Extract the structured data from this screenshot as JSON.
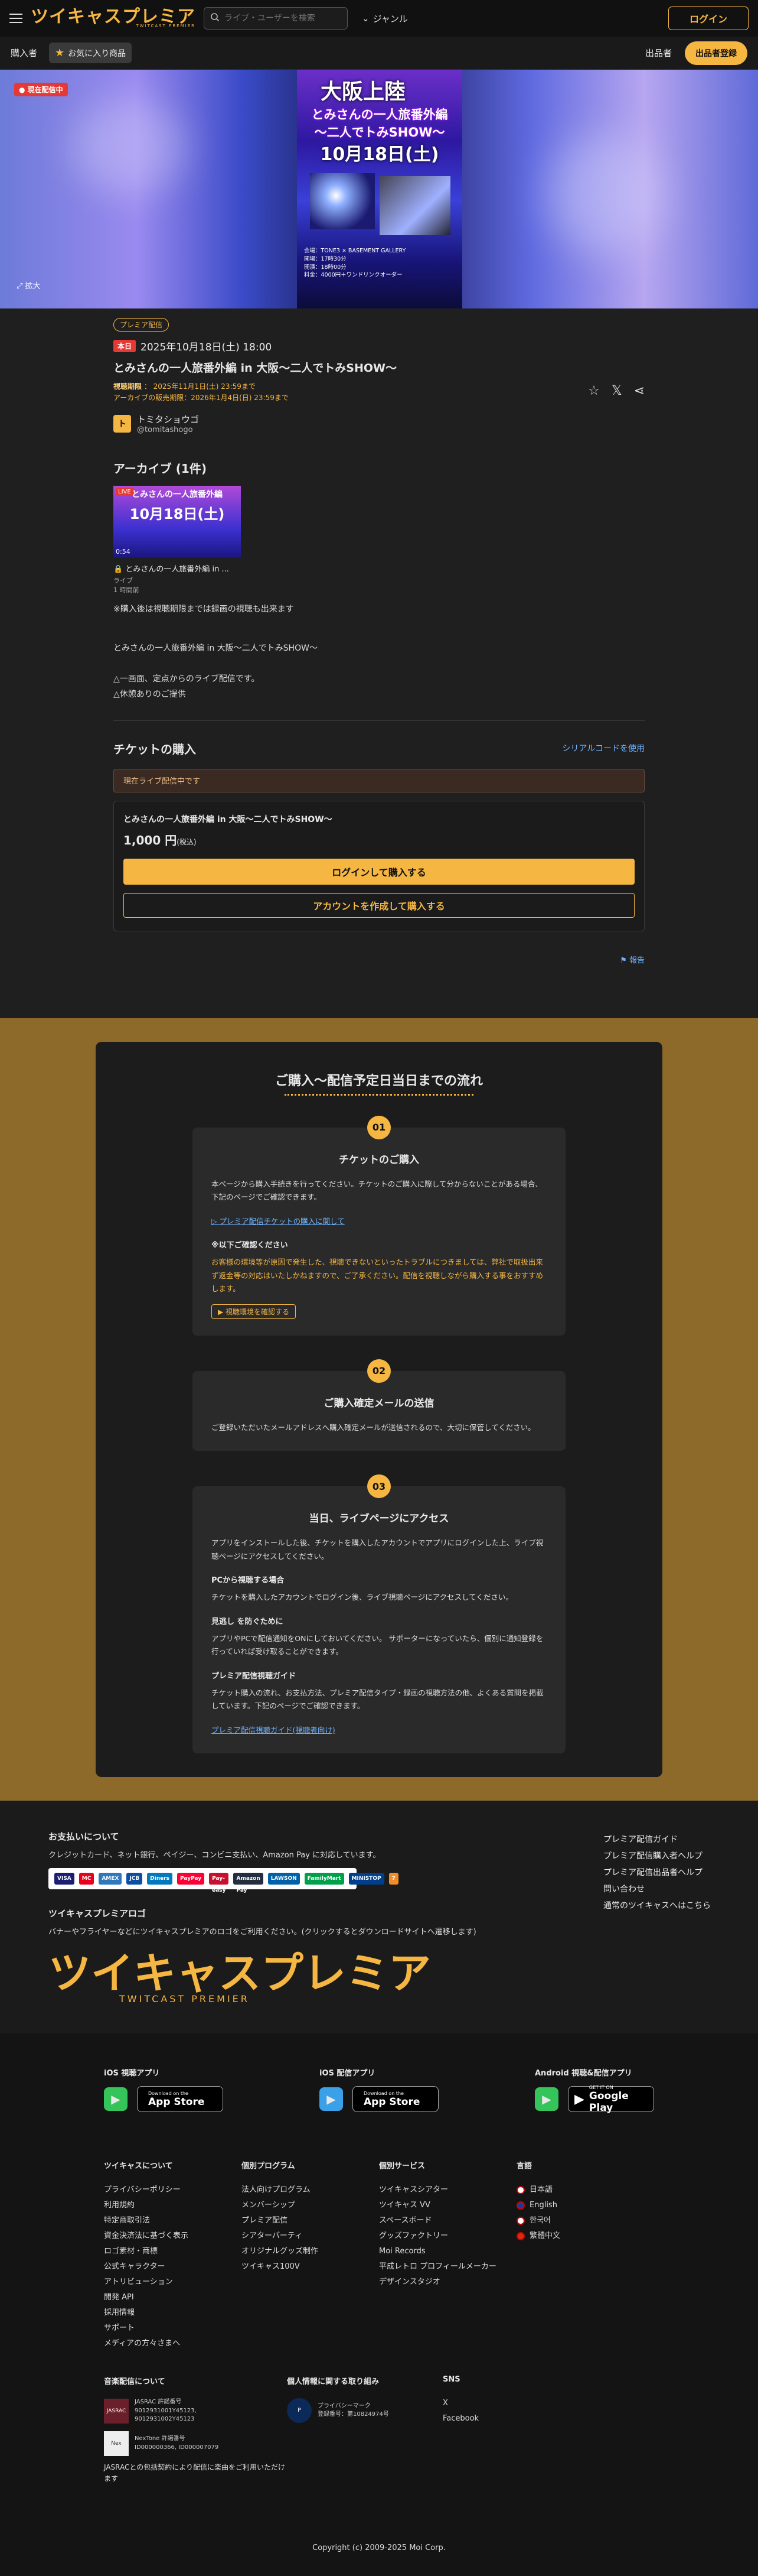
{
  "header": {
    "logo": "ツイキャスプレミア",
    "logo_sub": "TWITCAST PREMIER",
    "search_placeholder": "ライブ・ユーザーを検索",
    "genre": "ジャンル",
    "login": "ログイン"
  },
  "subnav": {
    "buyer": "購入者",
    "favorites": "お気に入り商品",
    "seller": "出品者",
    "register": "出品者登録"
  },
  "hero": {
    "live_tag": "● 現在配信中",
    "expand": "拡大",
    "poster_title": "大阪上陸",
    "poster_sub": "とみさんの一人旅番外編",
    "poster_sub2": "〜二人でトみSHOW〜",
    "poster_date": "10月18日(土)",
    "poster_info": "会場：TONE3 × BASEMENT GALLERY\n開場：17時30分\n開演：18時00分\n料金：4000円＋ワンドリンクオーダー"
  },
  "event": {
    "badge": "プレミア配信",
    "today": "本日",
    "datetime": "2025年10月18日(土) 18:00",
    "title": "とみさんの一人旅番外編 in 大阪〜二人でトみSHOW〜",
    "period_label": "視聴期限",
    "period_value": "2025年11月1日(土) 23:59まで",
    "sale_period": "アーカイブの販売期限：2026年1月4日(日) 23:59まで",
    "owner_name": "トミタショウゴ",
    "owner_id": "@tomitashogo",
    "archive_title": "アーカイブ (1件)",
    "archive_thumb_line1": "とみさんの一人旅番外編",
    "archive_thumb_line2": "10月18日(土)",
    "archive_live": "LIVE",
    "archive_duration": "0:54",
    "archive_name": "とみさんの一人旅番外編 in ...",
    "archive_type": "ライブ",
    "archive_ago": "1 時間前",
    "note": "※購入後は視聴期限までは録画の視聴も出来ます",
    "description": "とみさんの一人旅番外編 in 大阪〜二人でトみSHOW〜\n\n△一画面、定点からのライブ配信です。\n△休憩ありのご提供"
  },
  "ticket": {
    "heading": "チケットの購入",
    "serial": "シリアルコードを使用",
    "status": "現在ライブ配信中です",
    "name": "とみさんの一人旅番外編 in 大阪〜二人でトみSHOW〜",
    "price": "1,000 円",
    "tax": "(税込)",
    "login_buy": "ログインして購入する",
    "create_buy": "アカウントを作成して購入する",
    "report": "報告"
  },
  "flow": {
    "title": "ご購入〜配信予定日当日までの流れ",
    "step1": {
      "num": "01",
      "title": "チケットのご購入",
      "p1": "本ページから購入手続きを行ってください。チケットのご購入に際して分からないことがある場合、下記のページでご確認できます。",
      "link": "プレミア配信チケットの購入に関して",
      "h4": "※以下ご確認ください",
      "warn": "お客様の環境等が原因で発生した、視聴できないといったトラブルにつきましては、弊社で取扱出来ず返金等の対応はいたしかねますので、ご了承ください。配信を視聴しながら購入する事をおすすめします。",
      "check": "▶ 視聴環境を確認する"
    },
    "step2": {
      "num": "02",
      "title": "ご購入確定メールの送信",
      "p1": "ご登録いただいたメールアドレスへ購入確定メールが送信されるので、大切に保管してください。"
    },
    "step3": {
      "num": "03",
      "title": "当日、ライブページにアクセス",
      "p1": "アプリをインストールした後、チケットを購入したアカウントでアプリにログインした上、ライブ視聴ページにアクセスしてください。",
      "h_pc": "PCから視聴する場合",
      "p_pc": "チケットを購入したアカウントでログイン後、ライブ視聴ページにアクセスしてください。",
      "h_miss": "見逃し を防ぐために",
      "p_miss": "アプリやPCで配信通知をONにしておいてください。 サポーターになっていたら、個別に通知登録を行っていれば受け取ることができます。",
      "h_guide": "プレミア配信視聴ガイド",
      "p_guide": "チケット購入の流れ、お支払方法、プレミア配信タイプ・録画の視聴方法の他、よくある質問を掲載しています。下記のページでご確認できます。",
      "link_guide": "プレミア配信視聴ガイド(視聴者向け)"
    }
  },
  "payment": {
    "title": "お支払いについて",
    "desc": "クレジットカード、ネット銀行、ペイジー、コンビニ支払い、Amazon Pay に対応しています。",
    "cards": [
      "VISA",
      "MC",
      "AMEX",
      "JCB",
      "Diners",
      "PayPay",
      "Pay-easy",
      "Amazon Pay",
      "LAWSON",
      "FamilyMart",
      "MINISTOP",
      "7"
    ],
    "logo_title": "ツイキャスプレミアロゴ",
    "logo_desc": "バナーやフライヤーなどにツイキャスプレミアのロゴをご利用ください。(クリックするとダウンロードサイトへ遷移します)",
    "big_logo": "ツイキャスプレミア",
    "big_logo_sub": "TWITCAST PREMIER",
    "right_links": [
      "プレミア配信ガイド",
      "プレミア配信購入者ヘルプ",
      "プレミア配信出品者ヘルプ",
      "問い合わせ",
      "通常のツイキャスへはこちら"
    ]
  },
  "footer": {
    "apps": [
      {
        "label": "iOS 視聴アプリ",
        "store_small": "Download on the",
        "store_big": "App Store",
        "color": "#35c45a"
      },
      {
        "label": "iOS 配信アプリ",
        "store_small": "Download on the",
        "store_big": "App Store",
        "color": "#3aa0e8"
      },
      {
        "label": "Android 視聴&配信アプリ",
        "store_small": "GET IT ON",
        "store_big": "Google Play",
        "color": "#35c45a"
      }
    ],
    "cols": [
      {
        "title": "ツイキャスについて",
        "items": [
          "プライバシーポリシー",
          "利用規約",
          "特定商取引法",
          "資金決済法に基づく表示",
          "ロゴ素材・商標",
          "公式キャラクター",
          "アトリビューション",
          "開発 API",
          "採用情報",
          "サポート",
          "メディアの方々さまへ"
        ]
      },
      {
        "title": "個別プログラム",
        "items": [
          "法人向けプログラム",
          "メンバーシップ",
          "プレミア配信",
          "シアターパーティ",
          "オリジナルグッズ制作",
          "ツイキャス100V"
        ]
      },
      {
        "title": "個別サービス",
        "items": [
          "ツイキャスシアター",
          "ツイキャス VV",
          "スペースボード",
          "グッズファクトリー",
          "Moi Records",
          "平成レトロ プロフィールメーカー",
          "デザインスタジオ"
        ]
      },
      {
        "title": "言語",
        "items": [
          "日本語",
          "English",
          "한국어",
          "繁體中文"
        ]
      }
    ],
    "music_title": "音楽配信について",
    "jasrac": "JASRAC 許諾番号\n9012931001Y45123,\n9012931002Y45123",
    "nextone": "NexTone 許諾番号\nID000000366, ID000007079",
    "jasrac_note": "JASRACとの包括契約により配信に楽曲をご利用いただけます",
    "privacy_title": "個人情報に関する取り組み",
    "privacy_text": "プライバシーマーク\n登録番号：第10824974号",
    "sns_title": "SNS",
    "sns_items": [
      "X",
      "Facebook"
    ],
    "copyright": "Copyright (c) 2009-2025 Moi Corp."
  }
}
